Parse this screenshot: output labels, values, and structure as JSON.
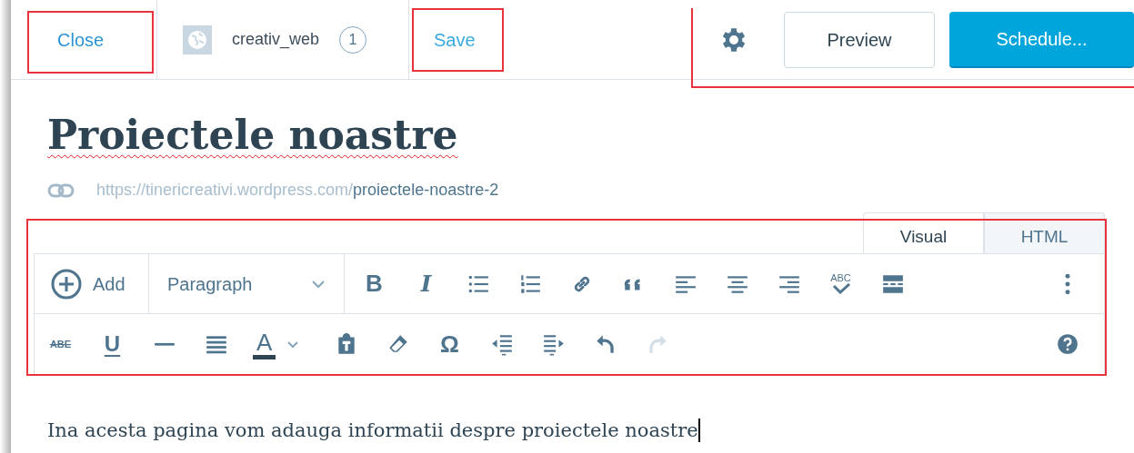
{
  "top_bar": {
    "close": "Close",
    "site": {
      "name": "creativ_web",
      "count": "1"
    },
    "save": "Save",
    "preview": "Preview",
    "schedule": "Schedule..."
  },
  "title": {
    "text": "Proiectele noastre",
    "misspelled": true
  },
  "permalink": {
    "base": "https://tinericreativi.wordpress.com/",
    "slug": "proiectele-noastre-2"
  },
  "editor_tabs": [
    {
      "label": "Visual",
      "selected": true
    },
    {
      "label": "HTML",
      "selected": false
    }
  ],
  "toolbar_rows": [
    [
      {
        "kind": "add",
        "label": "Add"
      },
      {
        "kind": "format-select",
        "value": "Paragraph"
      },
      {
        "kind": "bold",
        "glyph": "B"
      },
      {
        "kind": "italic",
        "glyph": "I"
      },
      {
        "kind": "bullet-list"
      },
      {
        "kind": "numbered-list"
      },
      {
        "kind": "link"
      },
      {
        "kind": "quote"
      },
      {
        "kind": "align-left"
      },
      {
        "kind": "align-center"
      },
      {
        "kind": "align-right"
      },
      {
        "kind": "spellcheck",
        "glyph": "ABC"
      },
      {
        "kind": "read-more"
      },
      {
        "kind": "more"
      }
    ],
    [
      {
        "kind": "strikethrough",
        "glyph": "ABE"
      },
      {
        "kind": "underline",
        "glyph": "U"
      },
      {
        "kind": "horizontal-line"
      },
      {
        "kind": "justify"
      },
      {
        "kind": "text-color",
        "glyph": "A"
      },
      {
        "kind": "paste-text"
      },
      {
        "kind": "eraser"
      },
      {
        "kind": "special-char",
        "glyph": "Ω"
      },
      {
        "kind": "outdent"
      },
      {
        "kind": "indent"
      },
      {
        "kind": "undo",
        "disabled": false
      },
      {
        "kind": "redo",
        "disabled": true
      },
      {
        "kind": "help"
      }
    ]
  ],
  "content": {
    "text": "Ina acesta pagina vom adauga informatii despre proiectele noastre",
    "cursor": true
  }
}
